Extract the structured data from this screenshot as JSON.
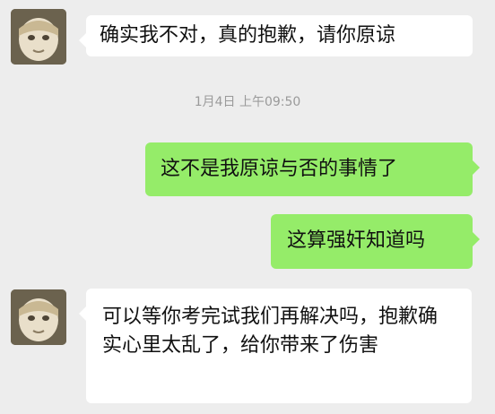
{
  "conversation": {
    "messages": [
      {
        "sender": "contact",
        "text": "确实我不对，真的抱歉，请你原谅"
      },
      {
        "sender": "me",
        "text": "这不是我原谅与否的事情了"
      },
      {
        "sender": "me",
        "text": "这算强奸知道吗"
      },
      {
        "sender": "contact",
        "text": "可以等你考完试我们再解决吗，抱歉确实心里太乱了，给你带来了伤害"
      }
    ],
    "timestamp": "1月4日 上午09:50"
  },
  "colors": {
    "background": "#ededed",
    "incoming_bubble": "#ffffff",
    "outgoing_bubble": "#95ec69",
    "timestamp_text": "#9a9a9a"
  },
  "icons": {
    "contact_avatar": "contact-avatar"
  }
}
